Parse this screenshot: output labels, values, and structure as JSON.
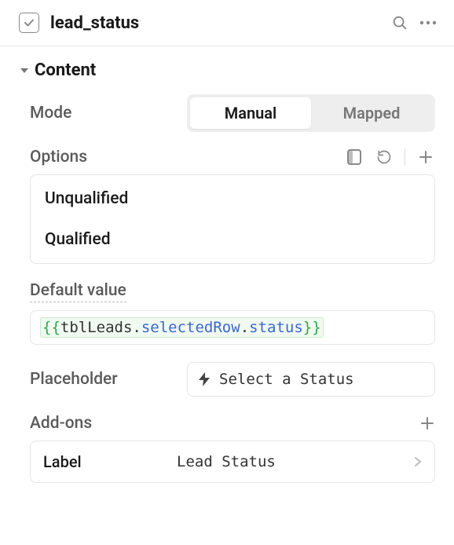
{
  "header": {
    "title": "lead_status"
  },
  "content": {
    "section_label": "Content",
    "mode": {
      "label": "Mode",
      "options": [
        "Manual",
        "Mapped"
      ],
      "selected": "Manual"
    },
    "options": {
      "label": "Options",
      "items": [
        "Unqualified",
        "Qualified"
      ]
    },
    "default_value": {
      "label": "Default value",
      "expression_text": "{{tblLeads.selectedRow.status}}",
      "expression_parts": {
        "ident": "tblLeads",
        "prop1": "selectedRow",
        "prop2": "status"
      }
    },
    "placeholder": {
      "label": "Placeholder",
      "value": "Select a Status"
    },
    "addons": {
      "label": "Add-ons",
      "items": [
        {
          "label": "Label",
          "value": "Lead Status"
        }
      ]
    }
  }
}
